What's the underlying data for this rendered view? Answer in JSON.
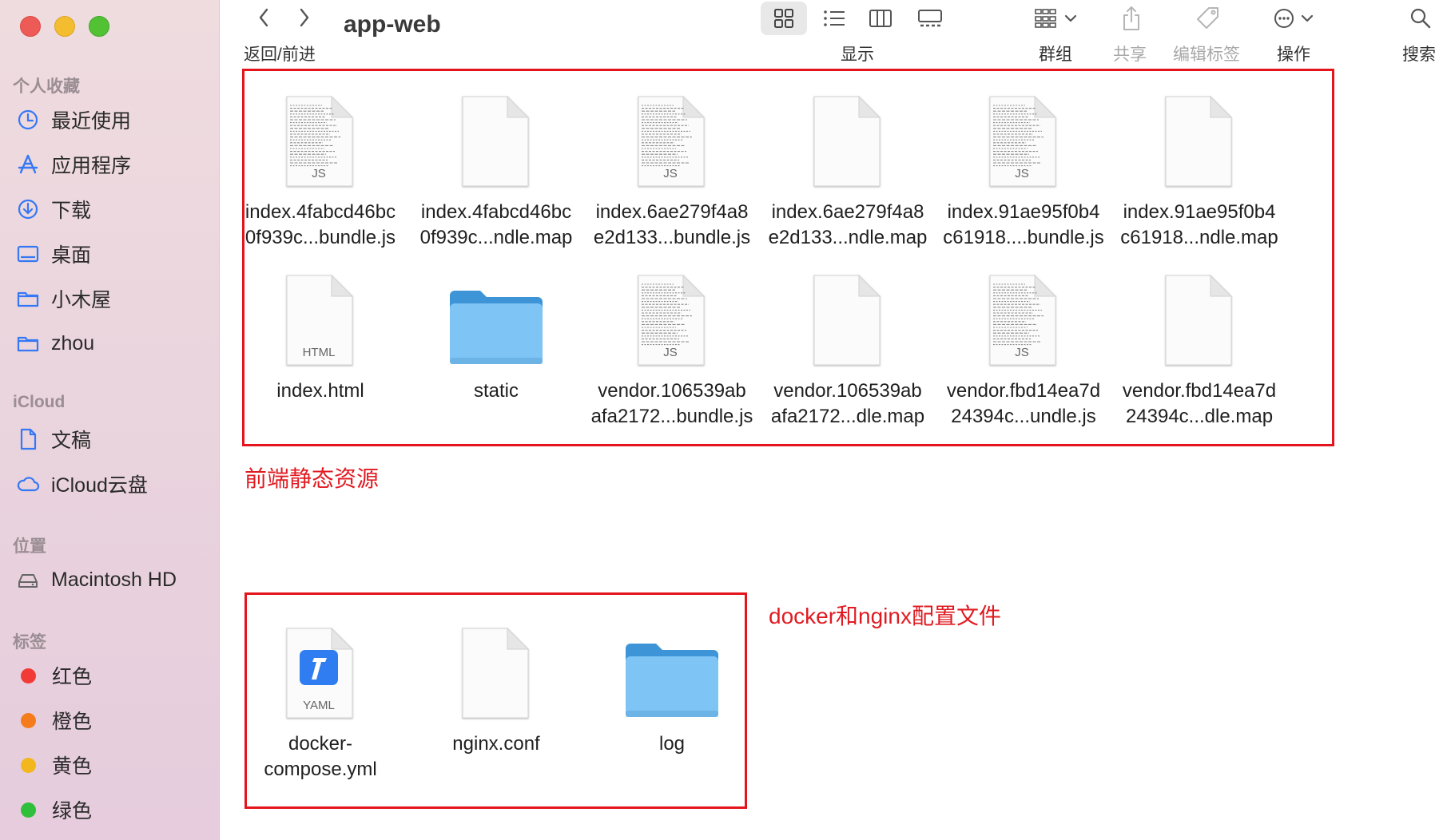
{
  "window": {
    "title": "app-web"
  },
  "toolbar": {
    "nav_label": "返回/前进",
    "view_label": "显示",
    "group_label": "群组",
    "share_label": "共享",
    "tags_label": "编辑标签",
    "action_label": "操作",
    "search_label": "搜索"
  },
  "sidebar": {
    "favorites_header": "个人收藏",
    "favorites": [
      {
        "label": "最近使用",
        "icon": "clock-icon"
      },
      {
        "label": "应用程序",
        "icon": "apps-icon"
      },
      {
        "label": "下载",
        "icon": "download-icon"
      },
      {
        "label": "桌面",
        "icon": "desktop-icon"
      },
      {
        "label": "小木屋",
        "icon": "folder-icon"
      },
      {
        "label": "zhou",
        "icon": "folder-icon"
      }
    ],
    "icloud_header": "iCloud",
    "icloud": [
      {
        "label": "文稿",
        "icon": "document-icon"
      },
      {
        "label": "iCloud云盘",
        "icon": "cloud-icon"
      }
    ],
    "locations_header": "位置",
    "locations": [
      {
        "label": "Macintosh HD",
        "icon": "disk-icon"
      }
    ],
    "tags_header": "标签",
    "tags": [
      {
        "label": "红色",
        "color": "#f23b36"
      },
      {
        "label": "橙色",
        "color": "#f47c1c"
      },
      {
        "label": "黄色",
        "color": "#f1b71c"
      },
      {
        "label": "绿色",
        "color": "#2fbf3a"
      }
    ]
  },
  "annotations": {
    "frontend": "前端静态资源",
    "docker": "docker和nginx配置文件"
  },
  "files_frontend": [
    {
      "name": "index.4fabcd46bc\n0f939c...bundle.js",
      "kind": "JS"
    },
    {
      "name": "index.4fabcd46bc\n0f939c...ndle.map",
      "kind": ""
    },
    {
      "name": "index.6ae279f4a8\ne2d133...bundle.js",
      "kind": "JS"
    },
    {
      "name": "index.6ae279f4a8\ne2d133...ndle.map",
      "kind": ""
    },
    {
      "name": "index.91ae95f0b4\nc61918....bundle.js",
      "kind": "JS"
    },
    {
      "name": "index.91ae95f0b4\nc61918...ndle.map",
      "kind": ""
    },
    {
      "name": "index.html",
      "kind": "HTML"
    },
    {
      "name": "static",
      "kind": "folder"
    },
    {
      "name": "vendor.106539ab\nafa2172...bundle.js",
      "kind": "JS"
    },
    {
      "name": "vendor.106539ab\nafa2172...dle.map",
      "kind": ""
    },
    {
      "name": "vendor.fbd14ea7d\n24394c...undle.js",
      "kind": "JS"
    },
    {
      "name": "vendor.fbd14ea7d\n24394c...dle.map",
      "kind": ""
    }
  ],
  "files_config": [
    {
      "name": "docker-\ncompose.yml",
      "kind": "YAML"
    },
    {
      "name": "nginx.conf",
      "kind": ""
    },
    {
      "name": "log",
      "kind": "folder"
    }
  ]
}
